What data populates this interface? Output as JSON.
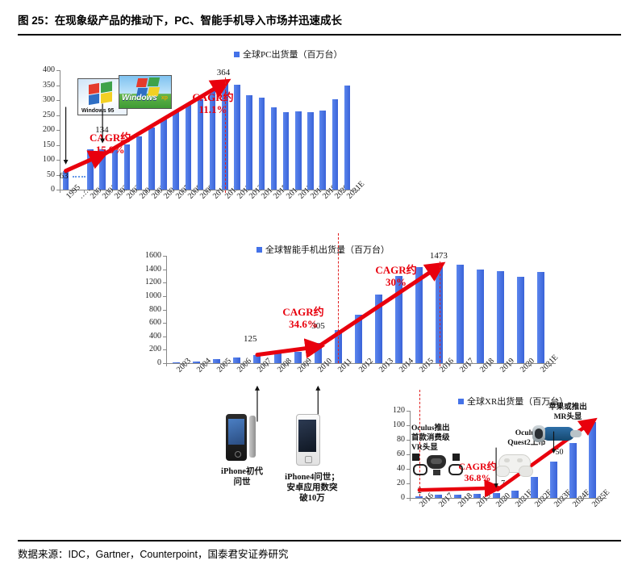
{
  "figure": {
    "title": "图 25：在现象级产品的推动下，PC、智能手机导入市场并迅速成长",
    "source": "数据来源：IDC，Gartner，Counterpoint，国泰君安证券研究"
  },
  "chart_data": [
    {
      "type": "bar",
      "id": "pc-shipments",
      "title": "",
      "legend": "全球PC出货量（百万台）",
      "legend_position": "top-center",
      "xlabel": "",
      "ylabel": "",
      "ylim": [
        0,
        400
      ],
      "yticks": [
        0,
        50,
        100,
        150,
        200,
        250,
        300,
        350,
        400
      ],
      "grid": false,
      "categories": [
        "1995",
        "……",
        "2000",
        "2001",
        "2002",
        "2003",
        "2004",
        "2005",
        "2006",
        "2007",
        "2008",
        "2009",
        "2010",
        "2011",
        "2012",
        "2013",
        "2014",
        "2015",
        "2016",
        "2017",
        "2018",
        "2019",
        "2020",
        "2021E"
      ],
      "values": [
        63,
        null,
        134,
        134,
        132,
        152,
        178,
        207,
        234,
        260,
        287,
        304,
        339,
        364,
        352,
        315,
        308,
        276,
        260,
        262,
        259,
        266,
        303,
        348
      ],
      "data_labels": [
        {
          "category": "1995",
          "value": "63"
        },
        {
          "category": "2001",
          "value": "134"
        },
        {
          "category": "2011",
          "value": "364"
        }
      ],
      "annotations": [
        {
          "text": "CAGR约\n15.9%",
          "color": "#E8000D"
        },
        {
          "text": "CAGR约\n11.1%",
          "color": "#E8000D"
        },
        {
          "text": "Windows 95",
          "kind": "image-callout",
          "points_to": "1995"
        },
        {
          "text": "Windows XP",
          "kind": "image-callout",
          "points_to": "2001"
        }
      ],
      "marker_line": {
        "at": "2011",
        "style": "dashed",
        "color": "#E02020"
      }
    },
    {
      "type": "bar",
      "id": "smartphone-shipments",
      "title": "",
      "legend": "全球智能手机出货量（百万台）",
      "legend_position": "top-center",
      "xlabel": "",
      "ylabel": "",
      "ylim": [
        0,
        1600
      ],
      "yticks": [
        0,
        200,
        400,
        600,
        800,
        1000,
        1200,
        1400,
        1600
      ],
      "grid": false,
      "categories": [
        "2003",
        "2004",
        "2005",
        "2006",
        "2007",
        "2008",
        "2009",
        "2010",
        "2011",
        "2012",
        "2013",
        "2014",
        "2015",
        "2016",
        "2017",
        "2018",
        "2019",
        "2020",
        "2021E"
      ],
      "values": [
        12,
        19,
        58,
        80,
        125,
        151,
        174,
        305,
        491,
        725,
        1019,
        1301,
        1437,
        1473,
        1466,
        1395,
        1373,
        1292,
        1355
      ],
      "data_labels": [
        {
          "category": "2007",
          "value": "125"
        },
        {
          "category": "2010",
          "value": "305"
        },
        {
          "category": "2016",
          "value": "1473"
        }
      ],
      "annotations": [
        {
          "text": "CAGR约\n34.6%",
          "color": "#E8000D"
        },
        {
          "text": "CAGR约\n30%",
          "color": "#E8000D"
        },
        {
          "text": "iPhone初代\n问世",
          "kind": "image-callout",
          "points_to": "2007"
        },
        {
          "text": "iPhone4问世；\n安卓应用数突\n破10万",
          "kind": "image-callout",
          "points_to": "2010"
        }
      ],
      "marker_line": {
        "at": "2011",
        "style": "dashed",
        "color": "#E02020"
      }
    },
    {
      "type": "bar",
      "id": "xr-shipments",
      "title": "",
      "legend": "全球XR出货量（百万台）",
      "legend_position": "top-center",
      "xlabel": "",
      "ylabel": "",
      "ylim": [
        0,
        120
      ],
      "yticks": [
        0,
        20,
        40,
        60,
        80,
        100,
        120
      ],
      "grid": false,
      "categories": [
        "2016",
        "2017",
        "2018",
        "2019",
        "2020",
        "2021E",
        "2022E",
        "2023E",
        "2024E",
        "2025E"
      ],
      "values": [
        2,
        4,
        5,
        6,
        7,
        10,
        29,
        50,
        76,
        105
      ],
      "data_labels": [
        {
          "category": "2016",
          "value": "2"
        },
        {
          "category": "2020",
          "value": "7"
        },
        {
          "category": "2023E",
          "value": "50"
        }
      ],
      "annotations": [
        {
          "text": "CAGR约\n36.8%",
          "color": "#E8000D"
        },
        {
          "text": "Oculus推出\n首款消费级\nVR头显",
          "kind": "image-callout",
          "points_to": "2016"
        },
        {
          "text": "Oculus\nQuest2上市",
          "kind": "image-callout",
          "points_to": "2020"
        },
        {
          "text": "苹果或推出\nMR头显",
          "kind": "image-callout",
          "points_to": "2023E"
        }
      ],
      "marker_line": {
        "at": "2016",
        "style": "dashed",
        "color": "#E02020"
      }
    }
  ],
  "colors": {
    "bar": "#4472E8",
    "accent_red": "#E8000D",
    "marker_red": "#E02020",
    "axis": "#888888",
    "text": "#111111"
  },
  "charts": {
    "pc": {
      "legend": "全球PC出货量（百万台）",
      "yticks": [
        "400",
        "350",
        "300",
        "250",
        "200",
        "150",
        "100",
        "50",
        "0"
      ],
      "xlabels": [
        "1995",
        "……",
        "2000",
        "2001",
        "2002",
        "2003",
        "2004",
        "2005",
        "2006",
        "2007",
        "2008",
        "2009",
        "2010",
        "2011",
        "2012",
        "2013",
        "2014",
        "2015",
        "2016",
        "2017",
        "2018",
        "2019",
        "2020",
        "2021E"
      ],
      "label_63": "63",
      "label_134": "134",
      "label_364": "364",
      "cagr1_line1": "CAGR约",
      "cagr1_line2": "15.9%",
      "cagr2_line1": "CAGR约",
      "cagr2_line2": "11.1%",
      "win95_alt": "Windows 95",
      "winxp_alt": "Windows XP"
    },
    "smartphone": {
      "legend": "全球智能手机出货量（百万台）",
      "yticks": [
        "1600",
        "1400",
        "1200",
        "1000",
        "800",
        "600",
        "400",
        "200",
        "0"
      ],
      "xlabels": [
        "2003",
        "2004",
        "2005",
        "2006",
        "2007",
        "2008",
        "2009",
        "2010",
        "2011",
        "2012",
        "2013",
        "2014",
        "2015",
        "2016",
        "2017",
        "2018",
        "2019",
        "2020",
        "2021E"
      ],
      "label_125": "125",
      "label_305": "305",
      "label_1473": "1473",
      "cagr1_line1": "CAGR约",
      "cagr1_line2": "34.6%",
      "cagr2_line1": "CAGR约",
      "cagr2_line2": "30%",
      "note_iphone_l1": "iPhone初代",
      "note_iphone_l2": "问世",
      "note_iphone4_l1": "iPhone4问世；",
      "note_iphone4_l2": "安卓应用数突",
      "note_iphone4_l3": "破10万"
    },
    "xr": {
      "legend": "全球XR出货量（百万台）",
      "yticks": [
        "120",
        "100",
        "80",
        "60",
        "40",
        "20",
        "0"
      ],
      "xlabels": [
        "2016",
        "2017",
        "2018",
        "2019",
        "2020",
        "2021E",
        "2022E",
        "2023E",
        "2024E",
        "2025E"
      ],
      "label_2": "2",
      "label_7": "7",
      "label_50": "50",
      "cagr_line1": "CAGR约",
      "cagr_line2": "36.8%",
      "note_oculus_l1": "Oculus推出",
      "note_oculus_l2": "首款消费级",
      "note_oculus_l3": "VR头显",
      "note_quest_l1": "Oculus",
      "note_quest_l2": "Quest2上市",
      "note_apple_l1": "苹果或推出",
      "note_apple_l2": "MR头显"
    }
  }
}
